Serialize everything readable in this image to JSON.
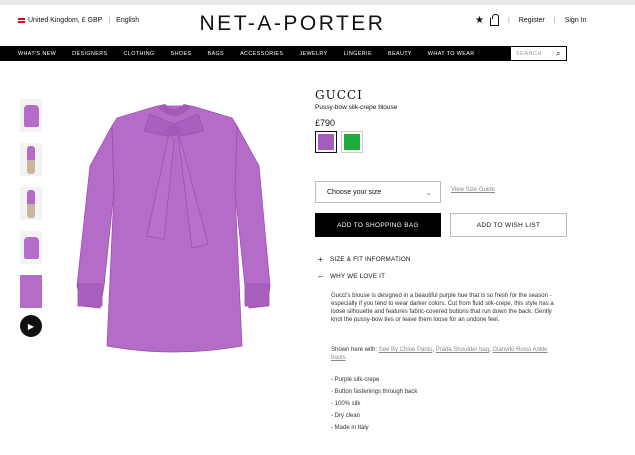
{
  "header": {
    "locale": "United Kingdom, £ GBP",
    "language": "English",
    "logo": "NET-A-PORTER",
    "register": "Register",
    "signin": "Sign In",
    "divider": "|"
  },
  "nav": {
    "items": [
      "WHAT'S NEW",
      "DESIGNERS",
      "CLOTHING",
      "SHOES",
      "BAGS",
      "ACCESSORIES",
      "JEWELRY",
      "LINGERIE",
      "BEAUTY",
      "WHAT TO WEAR"
    ],
    "search_placeholder": "SEARCH"
  },
  "product": {
    "brand": "GUCCI",
    "name": "Pussy-bow silk-crepe blouse",
    "price": "£790",
    "swatches": [
      {
        "color": "#a55cbc",
        "selected": true
      },
      {
        "color": "#1fae3c",
        "selected": false
      }
    ],
    "size_placeholder": "Choose your size",
    "size_guide": "View Size Guide",
    "add_to_bag": "ADD TO SHOPPING BAG",
    "add_to_wishlist": "ADD TO WISH LIST",
    "accordion": [
      {
        "symbol": "+",
        "label": "SIZE & FIT INFORMATION"
      },
      {
        "symbol": "–",
        "label": "WHY WE LOVE IT"
      }
    ],
    "description": "Gucci's blouse is designed in a beautiful purple hue that is so fresh for the season - especially if you tend to wear darker colors. Cut from fluid silk-crepe, this style has a loose silhouette and features fabric-covered buttons that run down the back. Gently knot the pussy-bow ties or leave them loose for an undone feel.",
    "shown_with_label": "Shown here with:",
    "shown_with_links": [
      "See By Chloé Pants",
      "Prada Shoulder bag",
      "Gianvito Rossi Ankle boots"
    ],
    "features": [
      "- Purple silk-crepe",
      "- Button fastenings through back",
      "- 100% silk",
      "- Dry clean",
      "- Made in Italy"
    ]
  },
  "colors": {
    "garment": "#b46cc8",
    "garment_shadow": "#9a52ae",
    "nav_bg": "#000000"
  }
}
